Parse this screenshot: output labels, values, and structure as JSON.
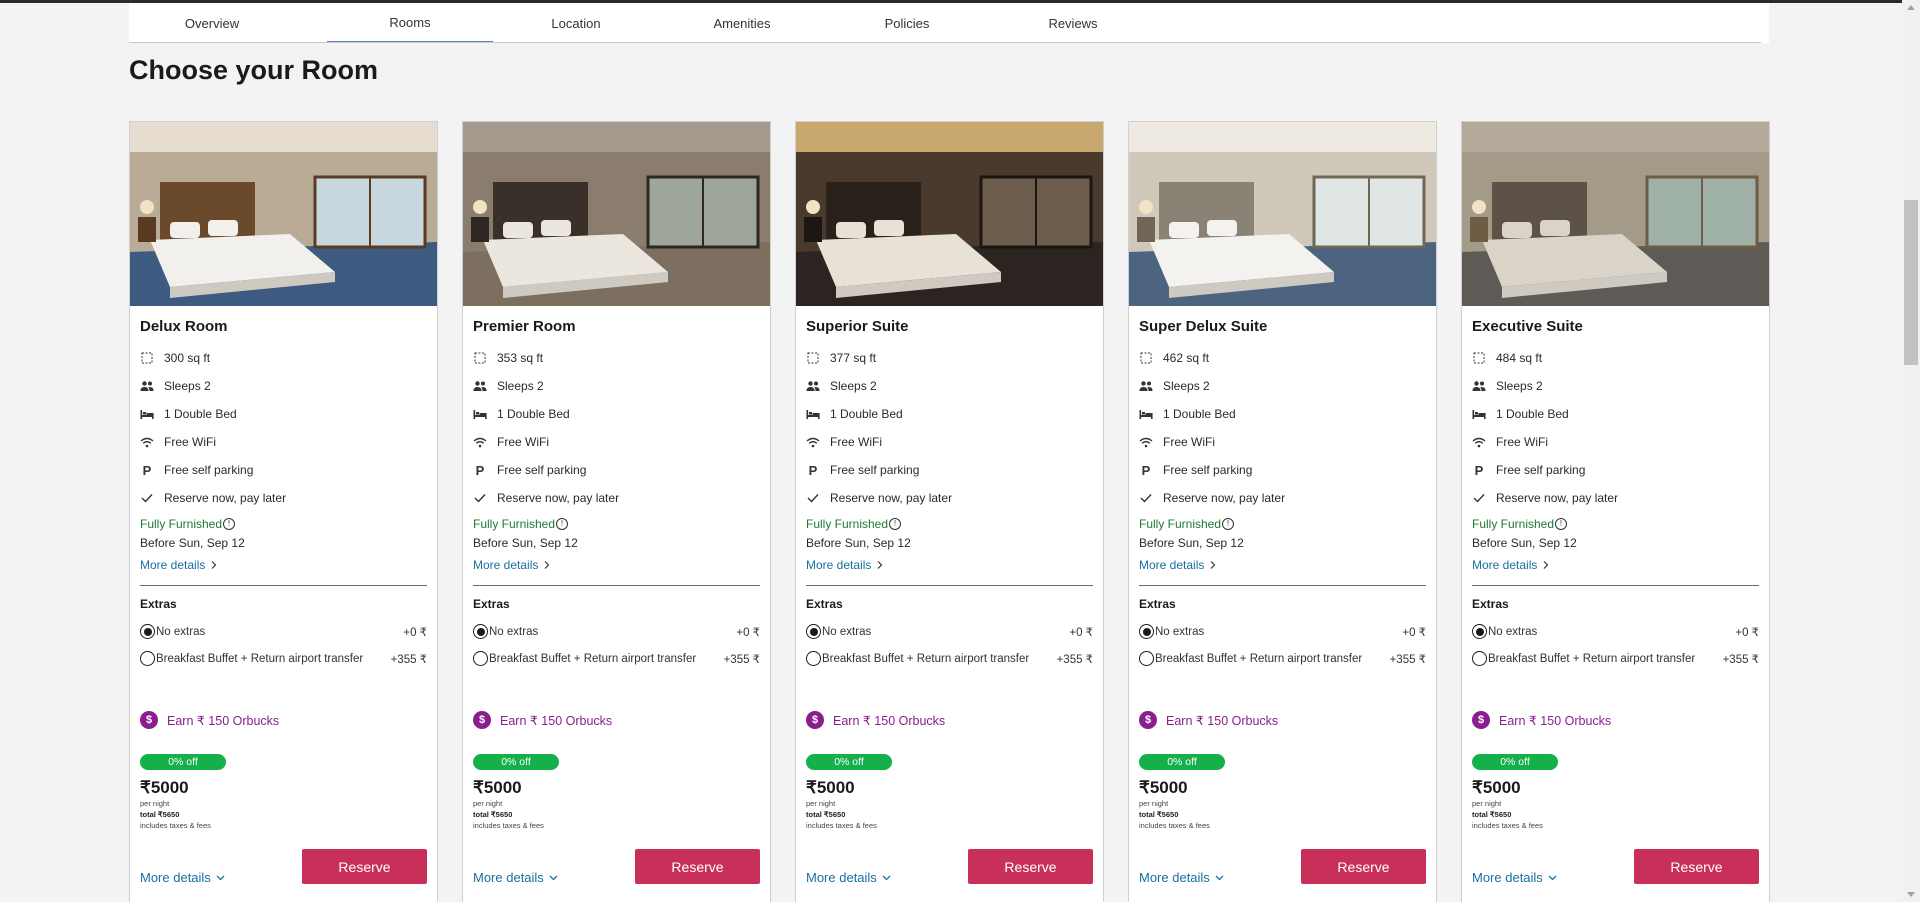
{
  "tabs": [
    "Overview",
    "Rooms",
    "Location",
    "Amenities",
    "Policies",
    "Reviews"
  ],
  "active_tab": "Rooms",
  "heading": "Choose your Room",
  "rooms": [
    {
      "name": "Delux Room",
      "area": "300 sq ft"
    },
    {
      "name": "Premier Room",
      "area": "353 sq ft"
    },
    {
      "name": "Superior Suite",
      "area": "377 sq ft"
    },
    {
      "name": "Super Delux Suite",
      "area": "462 sq ft"
    },
    {
      "name": "Executive Suite",
      "area": "484 sq ft"
    }
  ],
  "common": {
    "sleeps": "Sleeps 2",
    "bed": "1 Double Bed",
    "wifi": "Free WiFi",
    "parking": "Free self parking",
    "reserve_later": "Reserve now, pay later",
    "furnished": "Fully Furnished",
    "before": "Before Sun, Sep 12",
    "more_details": "More details",
    "extras_title": "Extras",
    "extras": [
      {
        "label": "No extras",
        "price": "+0 ₹",
        "selected": true
      },
      {
        "label": "Breakfast Buffet + Return airport transfer",
        "price": "+355 ₹",
        "selected": false
      }
    ],
    "earn": "Earn ₹ 150 Orbucks",
    "discount": "0% off",
    "price": "₹5000",
    "per_night": "per night",
    "total": "total ₹5650",
    "taxes": "includes taxes & fees",
    "reserve": "Reserve",
    "more_details_bottom": "More details"
  },
  "colors": {
    "accent": "#c8305a",
    "green_badge": "#15b04a",
    "furnished": "#1e7a32",
    "link": "#1a6fa3",
    "orbucks": "#8a1e8f",
    "active_tab_underline": "#5f7fd6"
  },
  "icons": {
    "area": "area-icon",
    "sleeps": "people-icon",
    "bed": "bed-icon",
    "wifi": "wifi-icon",
    "parking": "parking-icon",
    "reserve_later": "check-icon",
    "info": "info-icon",
    "chevron_right": "chevron-right-icon",
    "chevron_down": "chevron-down-icon",
    "coin": "dollar-coin-icon"
  }
}
